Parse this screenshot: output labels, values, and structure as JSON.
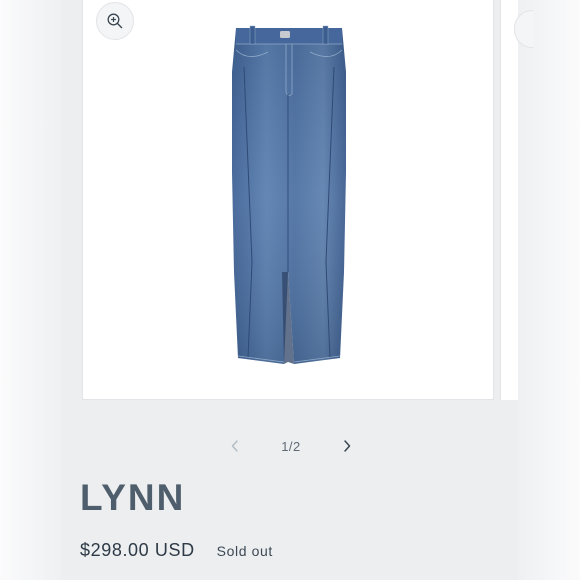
{
  "gallery": {
    "zoom_icon": "zoom-in-icon",
    "product_image_alt": "Denim maxi skirt with front slit",
    "pager": {
      "previous_icon": "chevron-left-icon",
      "next_icon": "chevron-right-icon",
      "counter": "1/2"
    }
  },
  "product": {
    "title": "LYNN",
    "price": "$298.00 USD",
    "badge": "Sold out"
  },
  "colors": {
    "background": "#f2f3f5",
    "title": "#4f5e6c",
    "denim": "#4a6ea0",
    "pager_disabled": "#b5bdc4",
    "pager_active": "#3a4652"
  }
}
